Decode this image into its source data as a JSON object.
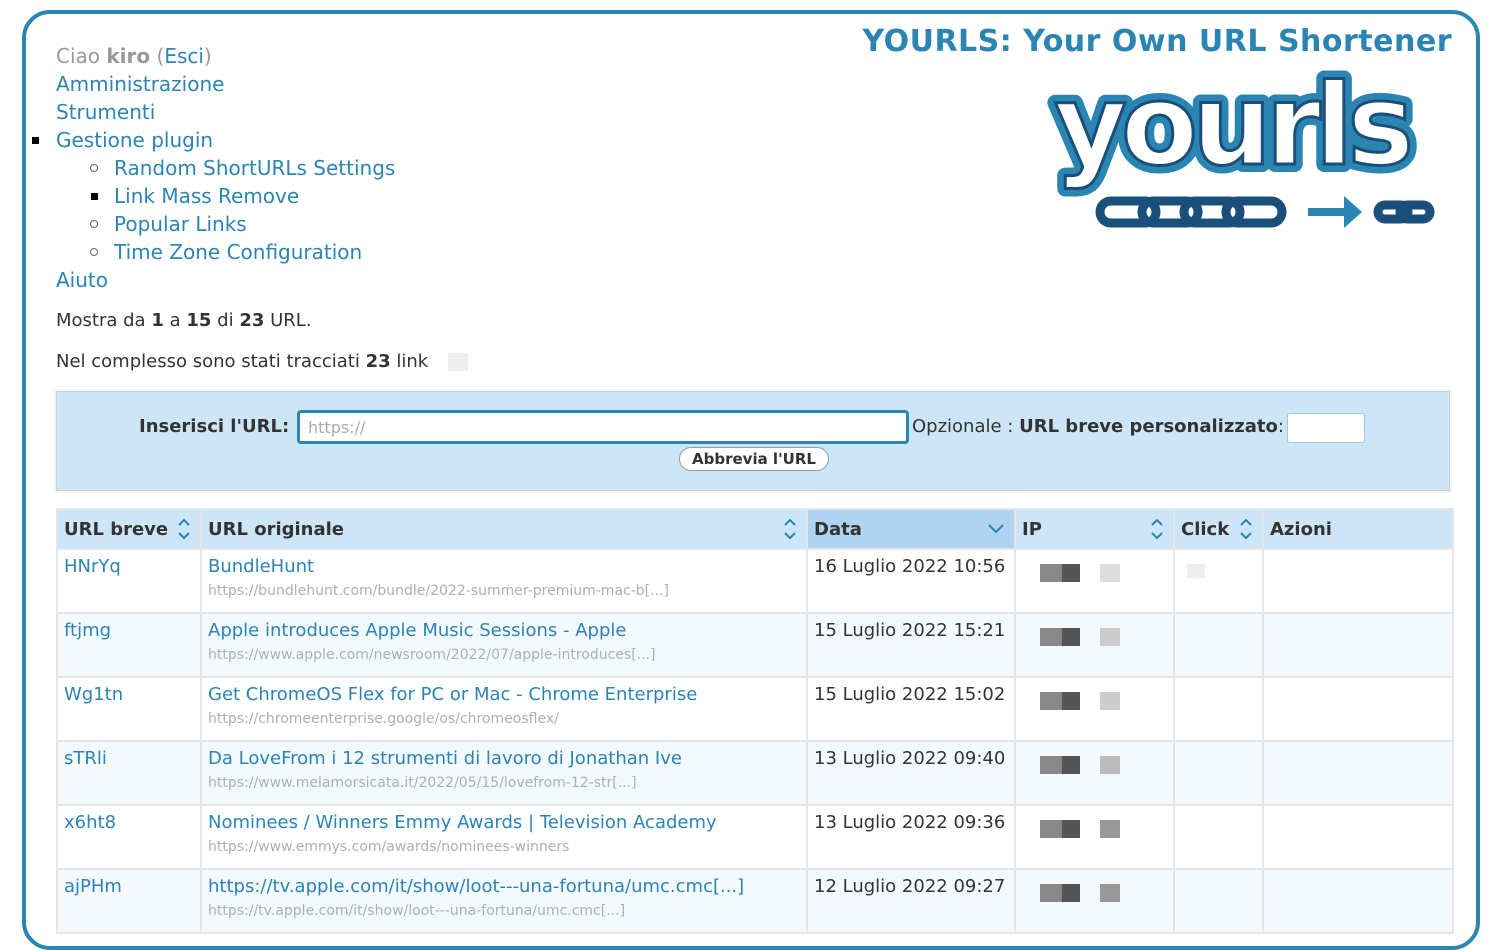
{
  "header": {
    "site_title": "YOURLS: Your Own URL Shortener",
    "logo_text": "yourls"
  },
  "nav": {
    "greeting_prefix": "Ciao",
    "user": "kiro",
    "logout_open": "(",
    "logout": "Esci",
    "logout_close": ")",
    "items": [
      {
        "label": "Amministrazione"
      },
      {
        "label": "Strumenti"
      },
      {
        "label": "Gestione plugin"
      },
      {
        "label": "Aiuto"
      }
    ],
    "plugin_items": [
      {
        "label": "Random ShortURLs Settings"
      },
      {
        "label": "Link Mass Remove"
      },
      {
        "label": "Popular Links"
      },
      {
        "label": "Time Zone Configuration"
      }
    ]
  },
  "info": {
    "showing_prefix": "Mostra da",
    "from": "1",
    "a": "a",
    "to": "15",
    "di": "di",
    "total": "23",
    "suffix": "URL.",
    "tracked_prefix": "Nel complesso sono stati tracciati",
    "tracked_count": "23",
    "tracked_suffix": "link"
  },
  "form": {
    "url_label": "Inserisci l'URL",
    "url_placeholder": "https://",
    "optional_label": "Opzionale",
    "keyword_label": "URL breve personalizzato",
    "submit_label": "Abbrevia l'URL"
  },
  "table": {
    "columns": [
      "URL breve",
      "URL originale",
      "Data",
      "IP",
      "Click",
      "Azioni"
    ],
    "rows": [
      {
        "keyword": "HNrYq",
        "title": "BundleHunt",
        "url": "https://bundlehunt.com/bundle/2022-summer-premium-mac-b[...]",
        "date": "16 Luglio 2022 10:56"
      },
      {
        "keyword": "ftjmg",
        "title": "Apple introduces Apple Music Sessions - Apple",
        "url": "https://www.apple.com/newsroom/2022/07/apple-introduces[...]",
        "date": "15 Luglio 2022 15:21"
      },
      {
        "keyword": "Wg1tn",
        "title": "Get ChromeOS Flex for PC or Mac - Chrome Enterprise",
        "url": "https://chromeenterprise.google/os/chromeosflex/",
        "date": "15 Luglio 2022 15:02"
      },
      {
        "keyword": "sTRli",
        "title": "Da LoveFrom i 12 strumenti di lavoro di Jonathan Ive",
        "url": "https://www.melamorsicata.it/2022/05/15/lovefrom-12-str[...]",
        "date": "13 Luglio 2022 09:40"
      },
      {
        "keyword": "x6ht8",
        "title": "Nominees / Winners Emmy Awards | Television Academy",
        "url": "https://www.emmys.com/awards/nominees-winners",
        "date": "13 Luglio 2022 09:36"
      },
      {
        "keyword": "ajPHm",
        "title": "https://tv.apple.com/it/show/loot---una-fortuna/umc.cmc[...]",
        "url": "https://tv.apple.com/it/show/loot---una-fortuna/umc.cmc[...]",
        "date": "12 Luglio 2022 09:27"
      }
    ]
  },
  "colors": {
    "accent": "#2a85b3",
    "form_bg": "#cde6f7",
    "header_active": "#b0d4ef"
  }
}
